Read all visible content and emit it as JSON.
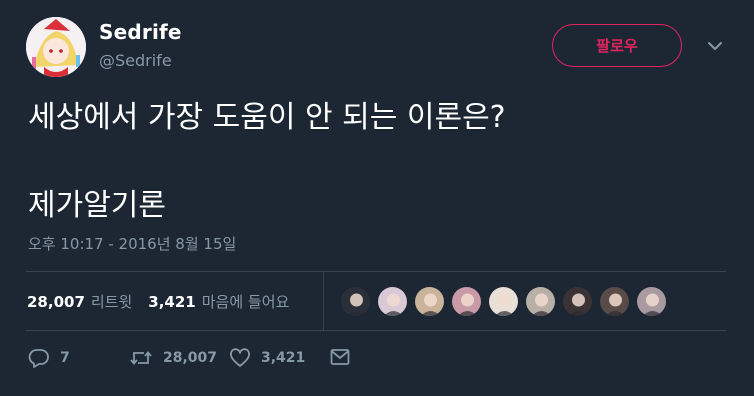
{
  "user": {
    "display_name": "Sedrife",
    "handle": "@Sedrife"
  },
  "follow_button_label": "팔로우",
  "tweet": {
    "line1": "세상에서 가장 도움이 안 되는 이론은?",
    "line2": "제가알기론"
  },
  "timestamp": "오후 10:17 - 2016년 8월 15일",
  "stats": {
    "retweets_count": "28,007",
    "retweets_label": "리트윗",
    "likes_count": "3,421",
    "likes_label": "마음에 들어요"
  },
  "likers": [
    {
      "color": "#2a2f3a"
    },
    {
      "color": "#d9c8d6"
    },
    {
      "color": "#c9b39a"
    },
    {
      "color": "#c89aa8"
    },
    {
      "color": "#e8dfd6"
    },
    {
      "color": "#b8b0a6"
    },
    {
      "color": "#3a3234"
    },
    {
      "color": "#5a4a48"
    },
    {
      "color": "#a89aa0"
    }
  ],
  "actions": {
    "reply_count": "7",
    "retweet_count": "28,007",
    "like_count": "3,421"
  },
  "colors": {
    "background": "#1c2733",
    "accent": "#e0245e",
    "muted": "#8899a6",
    "divider": "#38444d"
  }
}
